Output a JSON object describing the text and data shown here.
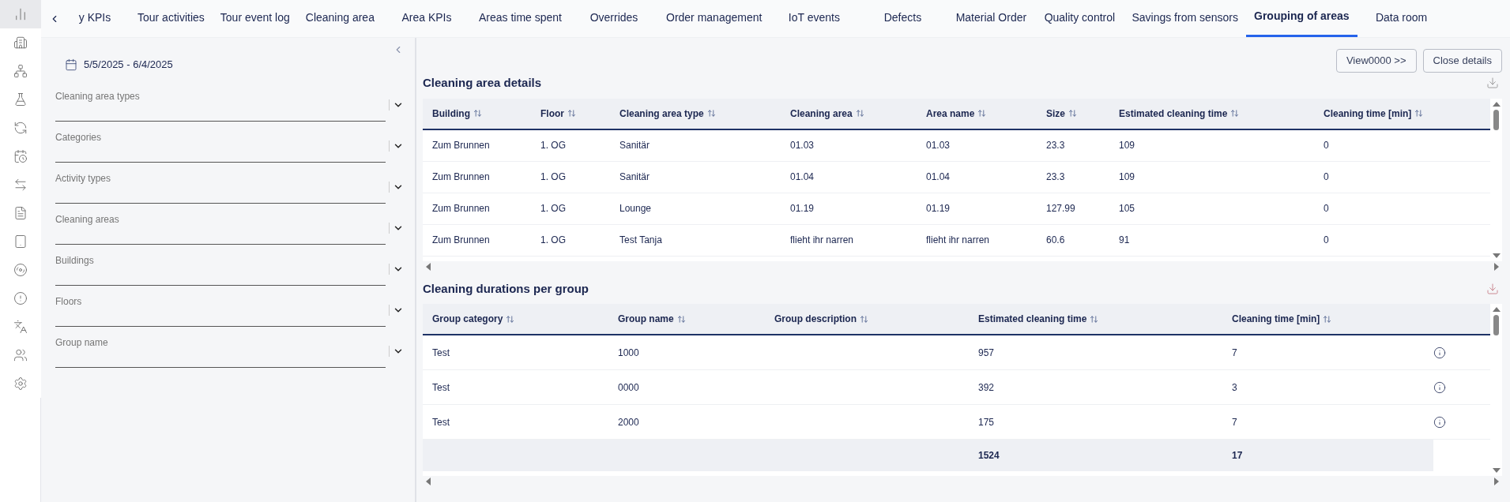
{
  "sidebar": {
    "items": [
      {
        "selected": true
      },
      {
        "selected": false
      },
      {
        "selected": false
      },
      {
        "selected": false
      },
      {
        "selected": false
      },
      {
        "selected": false
      },
      {
        "selected": false
      },
      {
        "selected": false
      },
      {
        "selected": false
      },
      {
        "selected": false
      },
      {
        "selected": false
      },
      {
        "selected": false
      },
      {
        "selected": false
      },
      {
        "selected": false
      }
    ]
  },
  "tabs": [
    {
      "label": "y KPIs",
      "selected": false
    },
    {
      "label": "Tour activities",
      "selected": false
    },
    {
      "label": "Tour event log",
      "selected": false
    },
    {
      "label": "Cleaning area",
      "selected": false
    },
    {
      "label": "Area KPIs",
      "selected": false
    },
    {
      "label": "Areas time spent",
      "selected": false
    },
    {
      "label": "Overrides",
      "selected": false
    },
    {
      "label": "Order management",
      "selected": false
    },
    {
      "label": "IoT events",
      "selected": false
    },
    {
      "label": "Defects",
      "selected": false
    },
    {
      "label": "Material Order",
      "selected": false
    },
    {
      "label": "Quality control",
      "selected": false
    },
    {
      "label": "Savings from sensors",
      "selected": false
    },
    {
      "label": "Grouping of areas",
      "selected": true
    },
    {
      "label": "Data room",
      "selected": false
    }
  ],
  "filters": {
    "date_range": "5/5/2025 - 6/4/2025",
    "fields": [
      {
        "placeholder": "Cleaning area types"
      },
      {
        "placeholder": "Categories"
      },
      {
        "placeholder": "Activity types"
      },
      {
        "placeholder": "Cleaning areas"
      },
      {
        "placeholder": "Buildings"
      },
      {
        "placeholder": "Floors"
      },
      {
        "placeholder": "Group name"
      }
    ]
  },
  "buttons": [
    "View0000 >>",
    "Close details"
  ],
  "area_details": {
    "title": "Cleaning area details",
    "columns": [
      "Building",
      "Floor",
      "Cleaning area type",
      "Cleaning area",
      "Area name",
      "Size",
      "Estimated cleaning time",
      "Cleaning time [min]"
    ],
    "rows": [
      [
        "Zum Brunnen",
        "1. OG",
        "Sanitär",
        "01.03",
        "01.03",
        "23.3",
        "109",
        "0"
      ],
      [
        "Zum Brunnen",
        "1. OG",
        "Sanitär",
        "01.04",
        "01.04",
        "23.3",
        "109",
        "0"
      ],
      [
        "Zum Brunnen",
        "1. OG",
        "Lounge",
        "01.19",
        "01.19",
        "127.99",
        "105",
        "0"
      ],
      [
        "Zum Brunnen",
        "1. OG",
        "Test Tanja",
        "flieht ihr narren",
        "flieht ihr narren",
        "60.6",
        "91",
        "0"
      ]
    ]
  },
  "group_durations": {
    "title": "Cleaning durations per group",
    "columns": [
      "Group category",
      "Group name",
      "Group description",
      "Estimated cleaning time",
      "Cleaning time [min]"
    ],
    "rows": [
      {
        "group_category": "Test",
        "group_name": "1000",
        "estimated_cleaning_time": "957",
        "cleaning_time": "7"
      },
      {
        "group_category": "Test",
        "group_name": "0000",
        "estimated_cleaning_time": "392",
        "cleaning_time": "3"
      },
      {
        "group_category": "Test",
        "group_name": "2000",
        "estimated_cleaning_time": "175",
        "cleaning_time": "7"
      }
    ],
    "totals": {
      "estimated_cleaning_time": "1524",
      "cleaning_time": "17"
    }
  }
}
